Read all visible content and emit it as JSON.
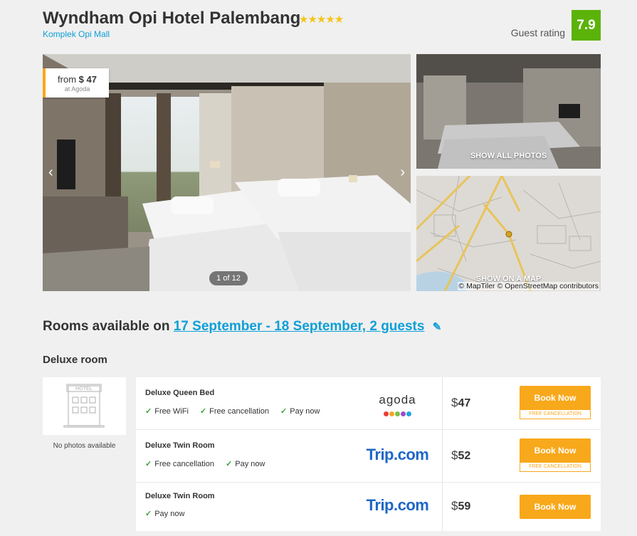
{
  "hotel": {
    "name": "Wyndham Opi Hotel Palembang",
    "stars": "★★★★★",
    "location": "Komplek Opi Mall",
    "rating_label": "Guest rating",
    "rating": "7.9"
  },
  "gallery": {
    "price_from": "from",
    "price": "$ 47",
    "price_source": "at Agoda",
    "counter": "1 of 12",
    "show_all_photos": "SHOW ALL PHOTOS",
    "show_on_map": "SHOW ON A MAP",
    "map_attribution": "© MapTiler © OpenStreetMap contributors",
    "prev_icon": "chevron-left-icon",
    "next_icon": "chevron-right-icon"
  },
  "rooms": {
    "heading_prefix": "Rooms available on",
    "dates": "17 September - 18 September, 2 guests",
    "room_type": "Deluxe room",
    "no_photos": "No photos available",
    "offers": [
      {
        "name": "Deluxe Queen Bed",
        "features": [
          "Free WiFi",
          "Free cancellation",
          "Pay now"
        ],
        "provider": "agoda",
        "currency": "$",
        "price": "47",
        "button": "Book Now",
        "badge": "FREE CANCELLATION"
      },
      {
        "name": "Deluxe Twin Room",
        "features": [
          "Free cancellation",
          "Pay now"
        ],
        "provider": "Trip.com",
        "currency": "$",
        "price": "52",
        "button": "Book Now",
        "badge": "FREE CANCELLATION"
      },
      {
        "name": "Deluxe Twin Room",
        "features": [
          "Pay now"
        ],
        "provider": "Trip.com",
        "currency": "$",
        "price": "59",
        "button": "Book Now"
      }
    ]
  },
  "colors": {
    "accent": "#0d9fd8",
    "button": "#f8a81b",
    "rating_bg": "#5bb30a",
    "check": "#3aa335"
  }
}
